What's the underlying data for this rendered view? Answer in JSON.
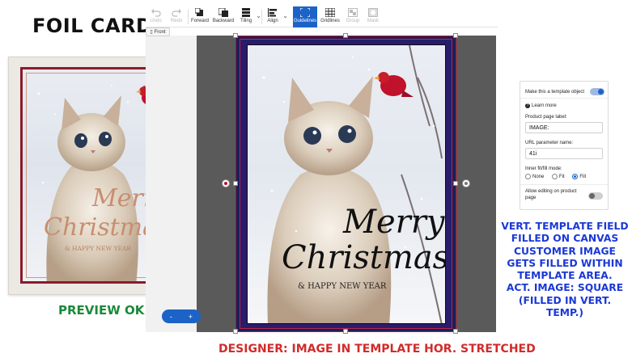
{
  "annotations": {
    "foil_title": "FOIL CARD",
    "preview_status": "PREVIEW OK",
    "right_note": [
      "VERT. TEMPLATE FIELD",
      "FILLED ON CANVAS",
      "CUSTOMER IMAGE",
      "GETS FILLED WITHIN",
      "TEMPLATE AREA.",
      "ACT. IMAGE: SQUARE",
      "(FILLED IN VERT. TEMP.)"
    ],
    "bottom_note": "DESIGNER: IMAGE IN TEMPLATE HOR. STRETCHED"
  },
  "toolbar": {
    "items": [
      {
        "label": "Undo",
        "icon": "undo-icon",
        "state": "disabled"
      },
      {
        "label": "Redo",
        "icon": "redo-icon",
        "state": "disabled"
      },
      {
        "label": "Forward",
        "icon": "bring-forward-icon",
        "state": "normal"
      },
      {
        "label": "Backward",
        "icon": "send-backward-icon",
        "state": "normal"
      },
      {
        "label": "Tiling",
        "icon": "tiling-icon",
        "state": "normal"
      },
      {
        "label": "Align",
        "icon": "align-icon",
        "state": "normal"
      },
      {
        "label": "Guidelines",
        "icon": "guidelines-icon",
        "state": "active"
      },
      {
        "label": "Gridlines",
        "icon": "gridlines-icon",
        "state": "normal"
      },
      {
        "label": "Group",
        "icon": "group-icon",
        "state": "disabled"
      },
      {
        "label": "Mask",
        "icon": "mask-icon",
        "state": "disabled"
      }
    ]
  },
  "page_tab": {
    "label": "Front"
  },
  "card_text": {
    "merry": "Merry",
    "christmas": "Christmas",
    "new_year": "& HAPPY NEW YEAR"
  },
  "zoom": {
    "minus": "-",
    "plus": "+"
  },
  "properties": {
    "template_toggle_label": "Make this a template object",
    "template_toggle_on": true,
    "learn_more": "Learn more",
    "product_page_label_caption": "Product page label:",
    "product_page_label_value": "IMAGE:",
    "url_param_caption": "URL parameter name:",
    "url_param_value": "41i",
    "fill_mode_caption": "Inner fit/fill mode:",
    "fill_options": [
      "None",
      "Fit",
      "Fill"
    ],
    "fill_selected": "Fill",
    "allow_editing_label_1": "Allow editing on product",
    "allow_editing_label_2": "page",
    "allow_editing_on": false
  },
  "colors": {
    "accent": "#1c63c8",
    "preview_ok": "#1a8a3a",
    "note_blue": "#1b38d6",
    "note_red": "#d12b2b",
    "card_border": "#8a1a2a",
    "canvas_gray": "#5a5a5a"
  }
}
